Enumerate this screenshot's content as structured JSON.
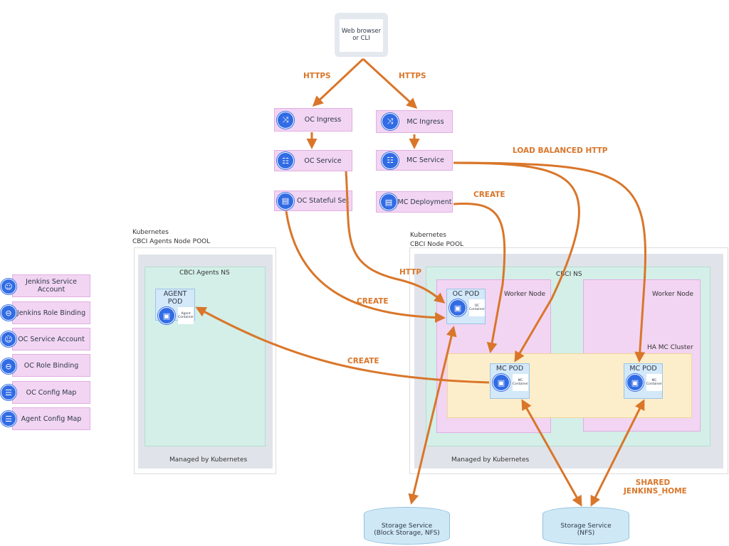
{
  "client": {
    "label_line1": "Web browser",
    "label_line2": "or CLI"
  },
  "edges": {
    "https_left": "HTTPS",
    "https_right": "HTTPS",
    "load_balanced": "LOAD BALANCED HTTP",
    "create_deployment": "CREATE",
    "http": "HTTP",
    "create_oc": "CREATE",
    "create_agent": "CREATE",
    "shared_line1": "SHARED",
    "shared_line2": "JENKINS_HOME"
  },
  "resources": {
    "oc_ingress": "OC Ingress",
    "mc_ingress": "MC Ingress",
    "oc_service": "OC Service",
    "mc_service": "MC Service",
    "oc_statefulset": "OC Stateful Set",
    "mc_deployment": "MC Deployment"
  },
  "legend": [
    {
      "label": "Jenkins Service Account",
      "icon": "service-account-icon"
    },
    {
      "label": "Jenkins Role Binding",
      "icon": "role-binding-icon"
    },
    {
      "label": "OC Service Account",
      "icon": "service-account-icon"
    },
    {
      "label": "OC Role Binding",
      "icon": "role-binding-icon"
    },
    {
      "label": "OC Config Map",
      "icon": "config-map-icon"
    },
    {
      "label": "Agent Config Map",
      "icon": "config-map-icon"
    }
  ],
  "agents_pool": {
    "line1": "Kubernetes",
    "line2": "CBCI Agents Node POOL",
    "ns": "CBCI Agents NS",
    "pod": "AGENT POD",
    "container": "Agent Container",
    "managed": "Managed by Kubernetes"
  },
  "node_pool": {
    "line1": "Kubernetes",
    "line2": "CBCI Node POOL",
    "ns": "CBCI  NS",
    "worker1": "Worker Node",
    "worker2": "Worker Node",
    "ha": "HA MC Cluster",
    "oc_pod": "OC POD",
    "oc_container": "OC Container",
    "mc_pod1": "MC POD",
    "mc_pod2": "MC POD",
    "mc_container": "MC Container",
    "managed": "Managed by Kubernetes"
  },
  "storage": {
    "block_line1": "Storage Service",
    "block_line2": "(Block Storage, NFS)",
    "nfs_line1": "Storage Service",
    "nfs_line2": "(NFS)"
  },
  "colors": {
    "arrow": "#d9762a",
    "resource": "#f2d5f2",
    "ns": "#d3efe8",
    "pod": "#d3e8f8",
    "ha": "#fdeecb",
    "k8s": "#326ce5"
  }
}
